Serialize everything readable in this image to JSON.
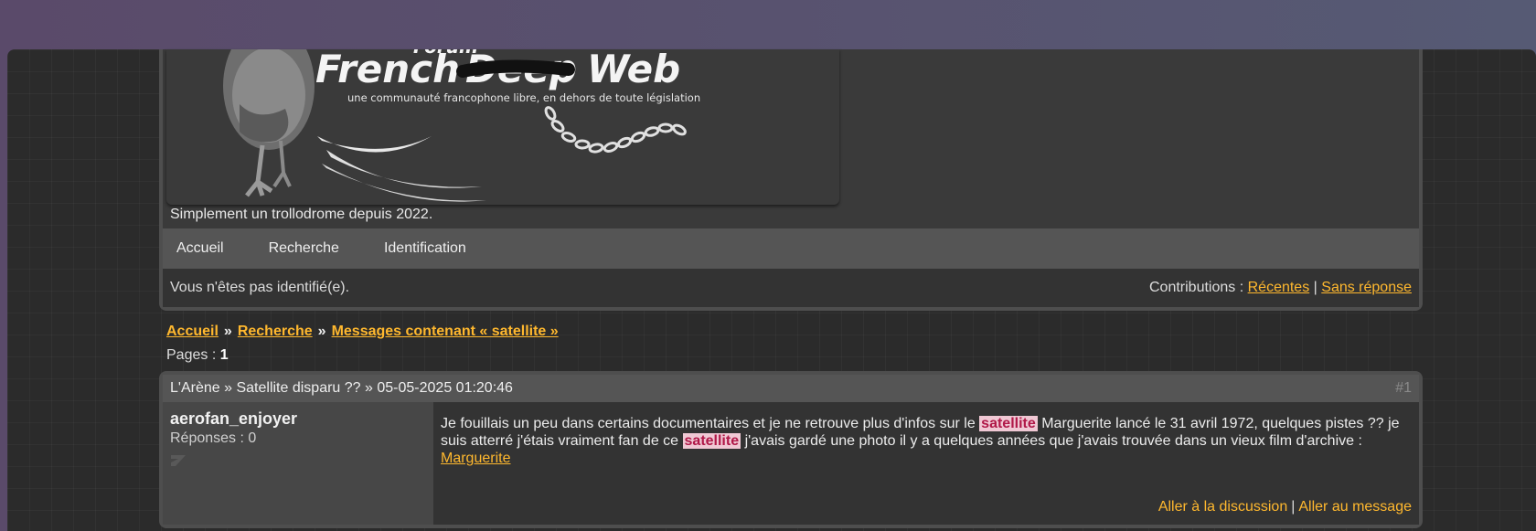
{
  "header": {
    "logo_title": "French",
    "logo_strike": "Deep",
    "logo_web": "Web",
    "logo_top": "Forum",
    "logo_tagline": "une communauté francophone libre, en dehors de toute législation",
    "description": "Simplement un trollodrome depuis 2022."
  },
  "nav": {
    "home": "Accueil",
    "search": "Recherche",
    "login": "Identification"
  },
  "status": {
    "left": "Vous n'êtes pas identifié(e).",
    "contributions_label": "Contributions :",
    "recent": "Récentes",
    "separator": "|",
    "unanswered": "Sans réponse"
  },
  "breadcrumb": {
    "home": "Accueil",
    "search": "Recherche",
    "query": "Messages contenant « satellite »",
    "sep": "»"
  },
  "pagination": {
    "label": "Pages :",
    "current": "1"
  },
  "post": {
    "forum": "L'Arène",
    "sep": "»",
    "topic": "Satellite disparu ??",
    "date": "05-05-2025 01:20:46",
    "number": "#1",
    "author": "aerofan_enjoyer",
    "replies": "Réponses : 0",
    "text_1": "Je fouillais un peu dans certains documentaires et je ne retrouve plus d'infos sur le",
    "highlight": "satellite",
    "text_2": "Marguerite lancé le 31 avril 1972, quelques pistes ?? je suis atterré j'étais vraiment fan de ce",
    "text_3": "j'avais gardé une photo il y a quelques années que j'avais trouvée dans un vieux film d'archive :",
    "link": "Marguerite",
    "goto_topic": "Aller à la discussion",
    "goto_sep": "|",
    "goto_post": "Aller au message"
  }
}
